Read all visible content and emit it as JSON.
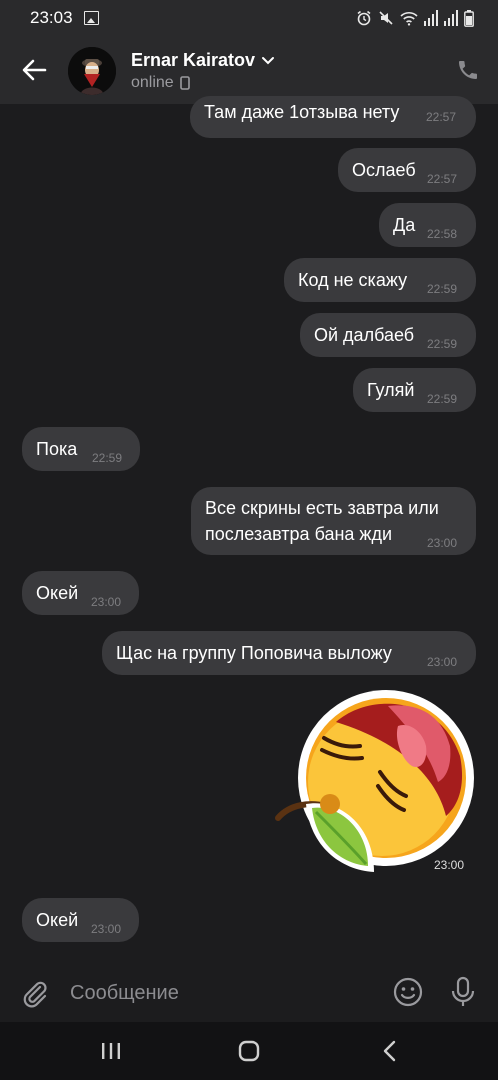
{
  "status_bar": {
    "time": "23:03",
    "icons": [
      "gallery-icon",
      "alarm-icon",
      "mute-icon",
      "wifi-icon",
      "signal-icon",
      "signal-icon",
      "battery-icon"
    ]
  },
  "header": {
    "contact_name": "Ernar Kairatov",
    "status": "online",
    "icons": [
      "back-arrow-icon",
      "chevron-down-icon",
      "phone-device-icon",
      "phone-call-icon"
    ]
  },
  "messages": [
    {
      "side": "out",
      "text": "Там даже 1отзыва нету",
      "time": "22:57"
    },
    {
      "side": "out",
      "text": "Ослаеб",
      "time": "22:57"
    },
    {
      "side": "out",
      "text": "Да",
      "time": "22:58"
    },
    {
      "side": "out",
      "text": "Код не скажу",
      "time": "22:59"
    },
    {
      "side": "out",
      "text": "Ой далбаеб",
      "time": "22:59"
    },
    {
      "side": "out",
      "text": "Гуляй",
      "time": "22:59"
    },
    {
      "side": "in",
      "text": "Пока",
      "time": "22:59"
    },
    {
      "side": "out",
      "text_line1": "Все скрины есть завтра или",
      "text_line2": "послезавтра бана жди",
      "time": "23:00"
    },
    {
      "side": "in",
      "text": "Окей",
      "time": "23:00"
    },
    {
      "side": "out",
      "text": "Щас на группу Поповича выложу",
      "time": "23:00"
    },
    {
      "side": "out",
      "type": "sticker",
      "sticker": "sleepy-peach-sticker",
      "time": "23:00"
    },
    {
      "side": "in",
      "text": "Окей",
      "time": "23:00"
    }
  ],
  "compose": {
    "placeholder": "Сообщение",
    "value": "",
    "icons": [
      "paperclip-icon",
      "emoji-icon",
      "microphone-icon"
    ]
  },
  "nav_bar": {
    "icons": [
      "recents-icon",
      "home-icon",
      "back-icon"
    ]
  },
  "colors": {
    "background": "#1c1c1e",
    "header": "#2a2a2c",
    "bubble": "#3a3a3d",
    "timestamp": "#7d7d80"
  }
}
